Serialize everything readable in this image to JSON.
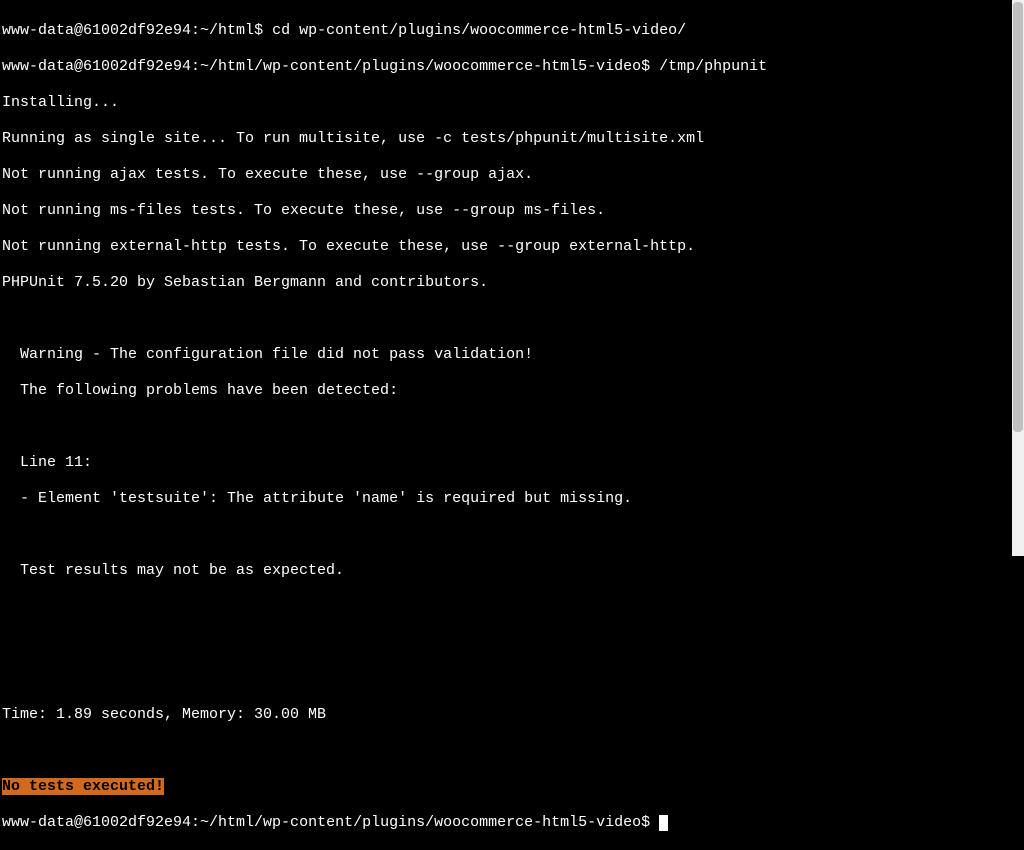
{
  "prompt1_user_host": "www-data@61002df92e94",
  "prompt1_path": "~/html",
  "prompt1_symbol": "$ ",
  "cmd1": "cd wp-content/plugins/woocommerce-html5-video/",
  "prompt2_user_host": "www-data@61002df92e94",
  "prompt2_path": "~/html/wp-content/plugins/woocommerce-html5-video",
  "prompt2_symbol": "$ ",
  "cmd2": "/tmp/phpunit",
  "out_installing": "Installing...",
  "out_multisite": "Running as single site... To run multisite, use -c tests/phpunit/multisite.xml",
  "out_ajax": "Not running ajax tests. To execute these, use --group ajax.",
  "out_msfiles": "Not running ms-files tests. To execute these, use --group ms-files.",
  "out_externalhttp": "Not running external-http tests. To execute these, use --group external-http.",
  "out_phpunit": "PHPUnit 7.5.20 by Sebastian Bergmann and contributors.",
  "out_warning": "  Warning - The configuration file did not pass validation!",
  "out_problems": "  The following problems have been detected:",
  "out_line11": "  Line 11:",
  "out_element": "  - Element 'testsuite': The attribute 'name' is required but missing.",
  "out_results": "  Test results may not be as expected.",
  "out_time": "Time: 1.89 seconds, Memory: 30.00 MB",
  "out_notests": "No tests executed!",
  "prompt3_user_host": "www-data@61002df92e94",
  "prompt3_path": "~/html/wp-content/plugins/woocommerce-html5-video",
  "prompt3_symbol": "$ "
}
